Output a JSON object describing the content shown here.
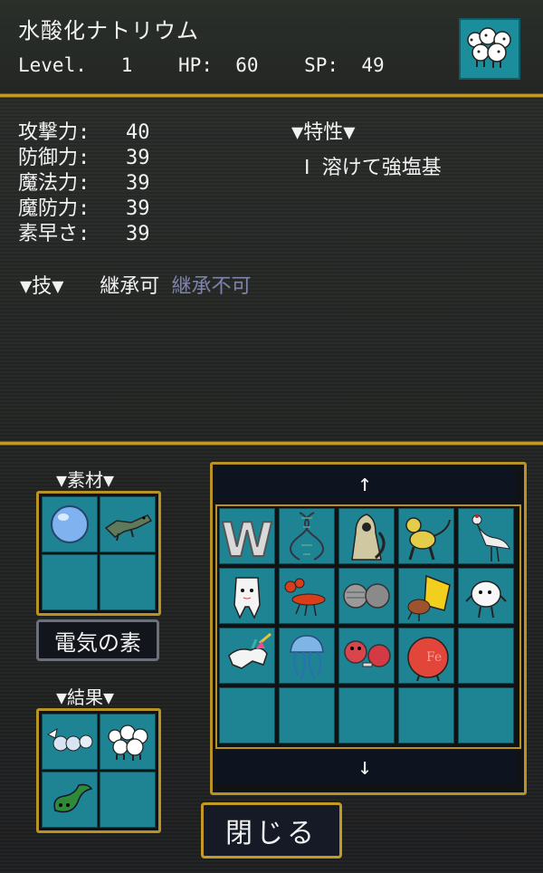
{
  "monster": {
    "name": "水酸化ナトリウム",
    "level_label": "Level.",
    "level": "1",
    "hp_label": "HP:",
    "hp": "60",
    "sp_label": "SP:",
    "sp": "49",
    "portrait_icon": "sheep-cluster-icon"
  },
  "stats": [
    {
      "label": "攻撃力:",
      "value": "40"
    },
    {
      "label": "防御力:",
      "value": "39"
    },
    {
      "label": "魔法力:",
      "value": "39"
    },
    {
      "label": "魔防力:",
      "value": "39"
    },
    {
      "label": "素早さ:",
      "value": "39"
    }
  ],
  "traits": {
    "title": "▼特性▼",
    "items": [
      "Ⅰ 溶けて強塩基"
    ]
  },
  "skills": {
    "title": "▼技▼",
    "tab_inheritable": "継承可",
    "tab_not_inheritable": "継承不可"
  },
  "materials": {
    "title": "▼素材▼",
    "slots": [
      "blue-orb-icon",
      "green-lizard-icon",
      "",
      ""
    ],
    "selected_name": "電気の素"
  },
  "results": {
    "title": "▼結果▼",
    "slots": [
      "winged-spheres-icon",
      "sheep-cluster-icon",
      "green-tadpole-icon",
      ""
    ]
  },
  "inventory": {
    "scroll_up": "↑",
    "scroll_down": "↓",
    "items": [
      "tungsten-w-icon",
      "dna-helix-icon",
      "hooded-reaper-icon",
      "yellow-monkey-icon",
      "white-crane-icon",
      "tooth-creature-icon",
      "red-lobster-icon",
      "gray-spheres-icon",
      "hermit-crab-icon",
      "white-egg-creature-icon",
      "white-unicorn-icon",
      "blue-jellyfish-icon",
      "red-spheres-icon",
      "red-blob-icon",
      "",
      "",
      "",
      "",
      "",
      ""
    ]
  },
  "close_label": "閉じる",
  "colors": {
    "gold": "#c39a22",
    "cell": "#1e8494",
    "dim_text": "#7e84ad"
  }
}
